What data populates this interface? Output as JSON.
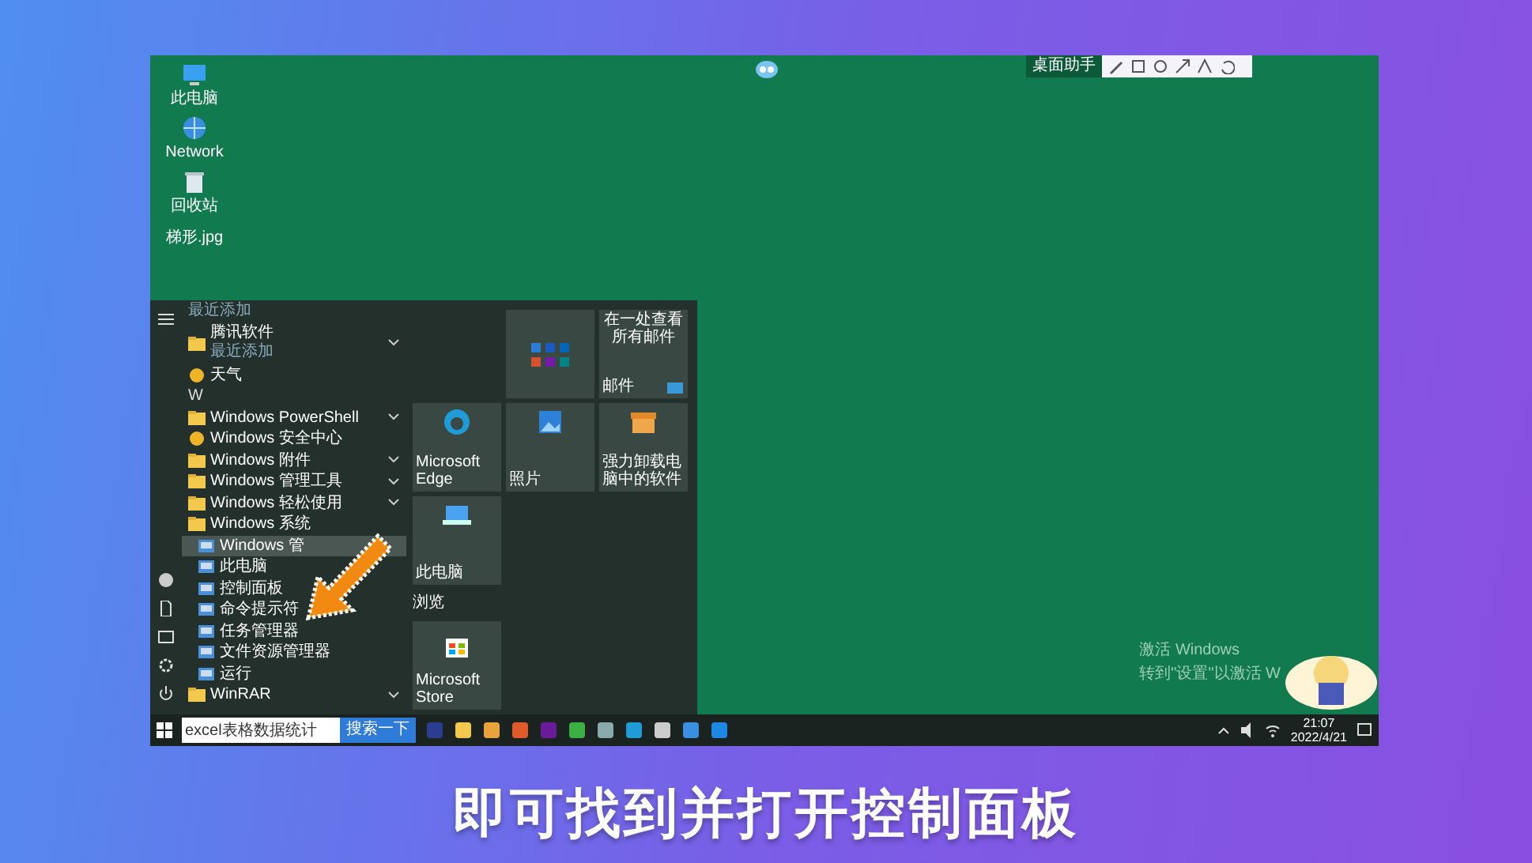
{
  "desktop_icons": [
    {
      "label": "此电脑"
    },
    {
      "label": "Network"
    },
    {
      "label": "回收站"
    },
    {
      "label": "梯形.jpg"
    }
  ],
  "top_toolbar": {
    "label": "桌面助手"
  },
  "start_menu": {
    "apps": [
      {
        "kind": "note",
        "label": "最近添加",
        "expandable": false,
        "selected": false
      },
      {
        "kind": "folder",
        "label": "腾讯软件",
        "sublabel": "最近添加",
        "expandable": true,
        "selected": false
      },
      {
        "kind": "app",
        "label": "天气",
        "expandable": false,
        "selected": false
      },
      {
        "kind": "header",
        "label": "W",
        "expandable": false,
        "selected": false
      },
      {
        "kind": "folder",
        "label": "Windows PowerShell",
        "expandable": true,
        "selected": false
      },
      {
        "kind": "app",
        "label": "Windows 安全中心",
        "expandable": false,
        "selected": false
      },
      {
        "kind": "folder",
        "label": "Windows 附件",
        "expandable": true,
        "selected": false
      },
      {
        "kind": "folder",
        "label": "Windows 管理工具",
        "expandable": true,
        "selected": false
      },
      {
        "kind": "folder",
        "label": "Windows 轻松使用",
        "expandable": true,
        "selected": false
      },
      {
        "kind": "folder",
        "label": "Windows 系统",
        "expandable": false,
        "selected": false
      },
      {
        "kind": "sub",
        "label": "Windows 管",
        "expandable": false,
        "selected": true
      },
      {
        "kind": "sub",
        "label": "此电脑",
        "expandable": false,
        "selected": false
      },
      {
        "kind": "sub",
        "label": "控制面板",
        "expandable": false,
        "selected": false
      },
      {
        "kind": "sub",
        "label": "命令提示符",
        "expandable": false,
        "selected": false
      },
      {
        "kind": "sub",
        "label": "任务管理器",
        "expandable": false,
        "selected": false
      },
      {
        "kind": "sub",
        "label": "文件资源管理器",
        "expandable": false,
        "selected": false
      },
      {
        "kind": "sub",
        "label": "运行",
        "expandable": false,
        "selected": false
      },
      {
        "kind": "folder",
        "label": "WinRAR",
        "expandable": true,
        "selected": false
      }
    ],
    "tiles": [
      {
        "kind": "blank"
      },
      {
        "kind": "office"
      },
      {
        "kind": "mail",
        "label": "在一处查看所有邮件",
        "footer": "邮件"
      },
      {
        "kind": "edge",
        "label": "Microsoft Edge"
      },
      {
        "kind": "photo",
        "label": "照片"
      },
      {
        "kind": "box",
        "label": "强力卸载电脑中的软件"
      },
      {
        "kind": "pc",
        "label": "此电脑"
      }
    ],
    "tile_group": {
      "label": "浏览"
    },
    "store_tile": {
      "label": "Microsoft Store"
    }
  },
  "taskbar": {
    "search_value": "excel表格数据统计",
    "search_button": "搜索一下",
    "time": "21:07",
    "date": "2022/4/21"
  },
  "activation": {
    "title": "激活 Windows",
    "text": "转到\"设置\"以激活 W"
  },
  "caption": "即可找到并打开控制面板"
}
